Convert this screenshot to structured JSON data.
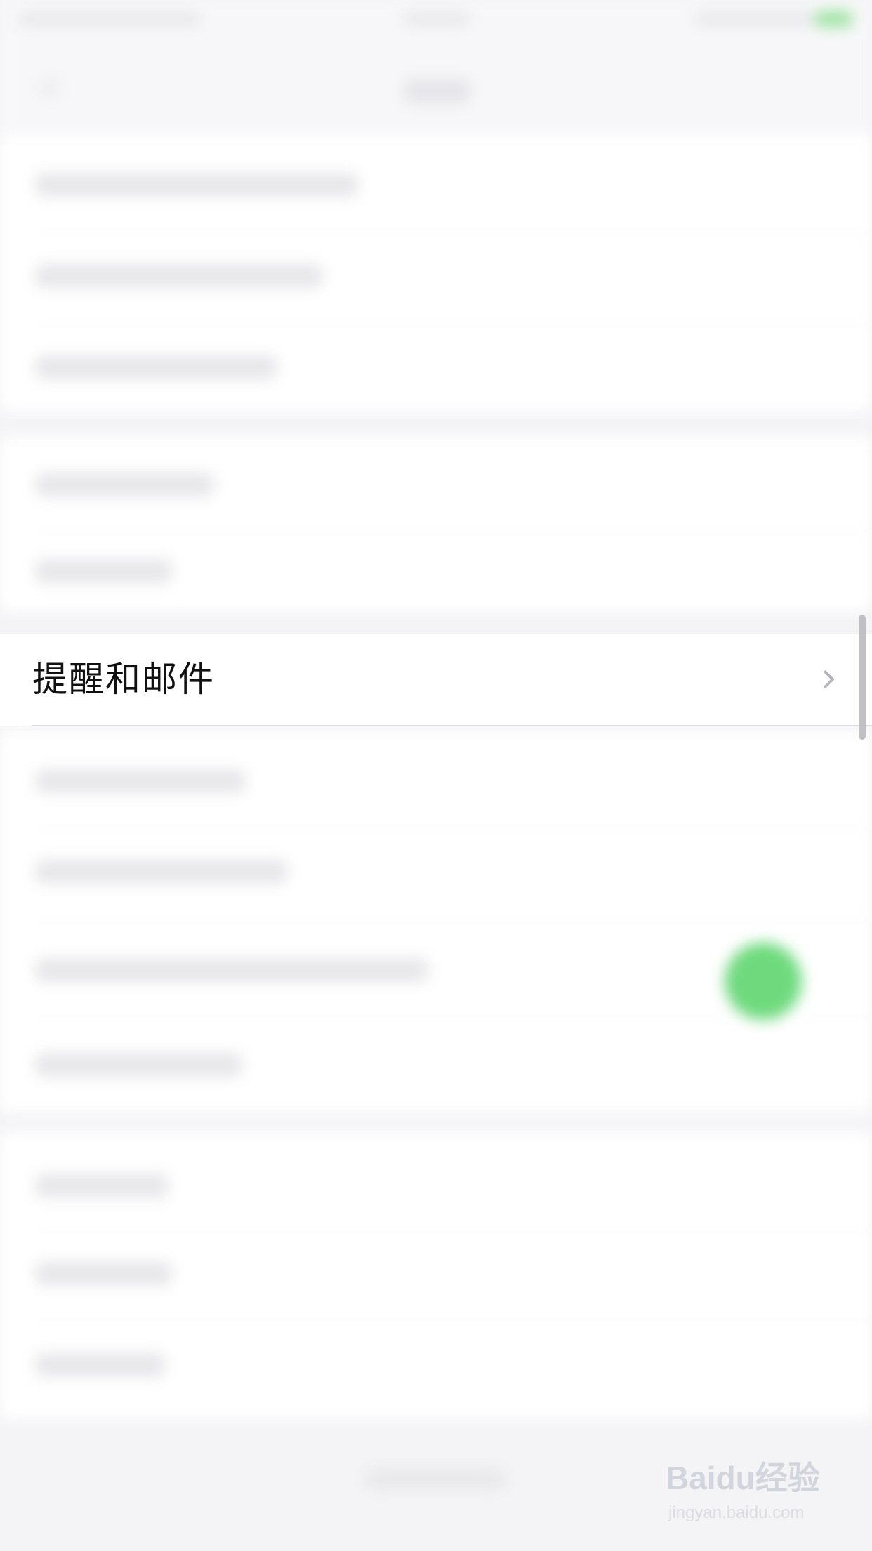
{
  "screen": {
    "focused_item": {
      "label": "提醒和邮件",
      "chevron_icon": "chevron-right-icon"
    }
  },
  "watermark": {
    "main": "Baidu经验",
    "sub": "jingyan.baidu.com"
  },
  "colors": {
    "background": "#f4f4f6",
    "card": "#ffffff",
    "text": "#111111",
    "muted": "#e7e7ea",
    "accent_green": "#55d466",
    "scrollbar": "#b9b9bf"
  }
}
